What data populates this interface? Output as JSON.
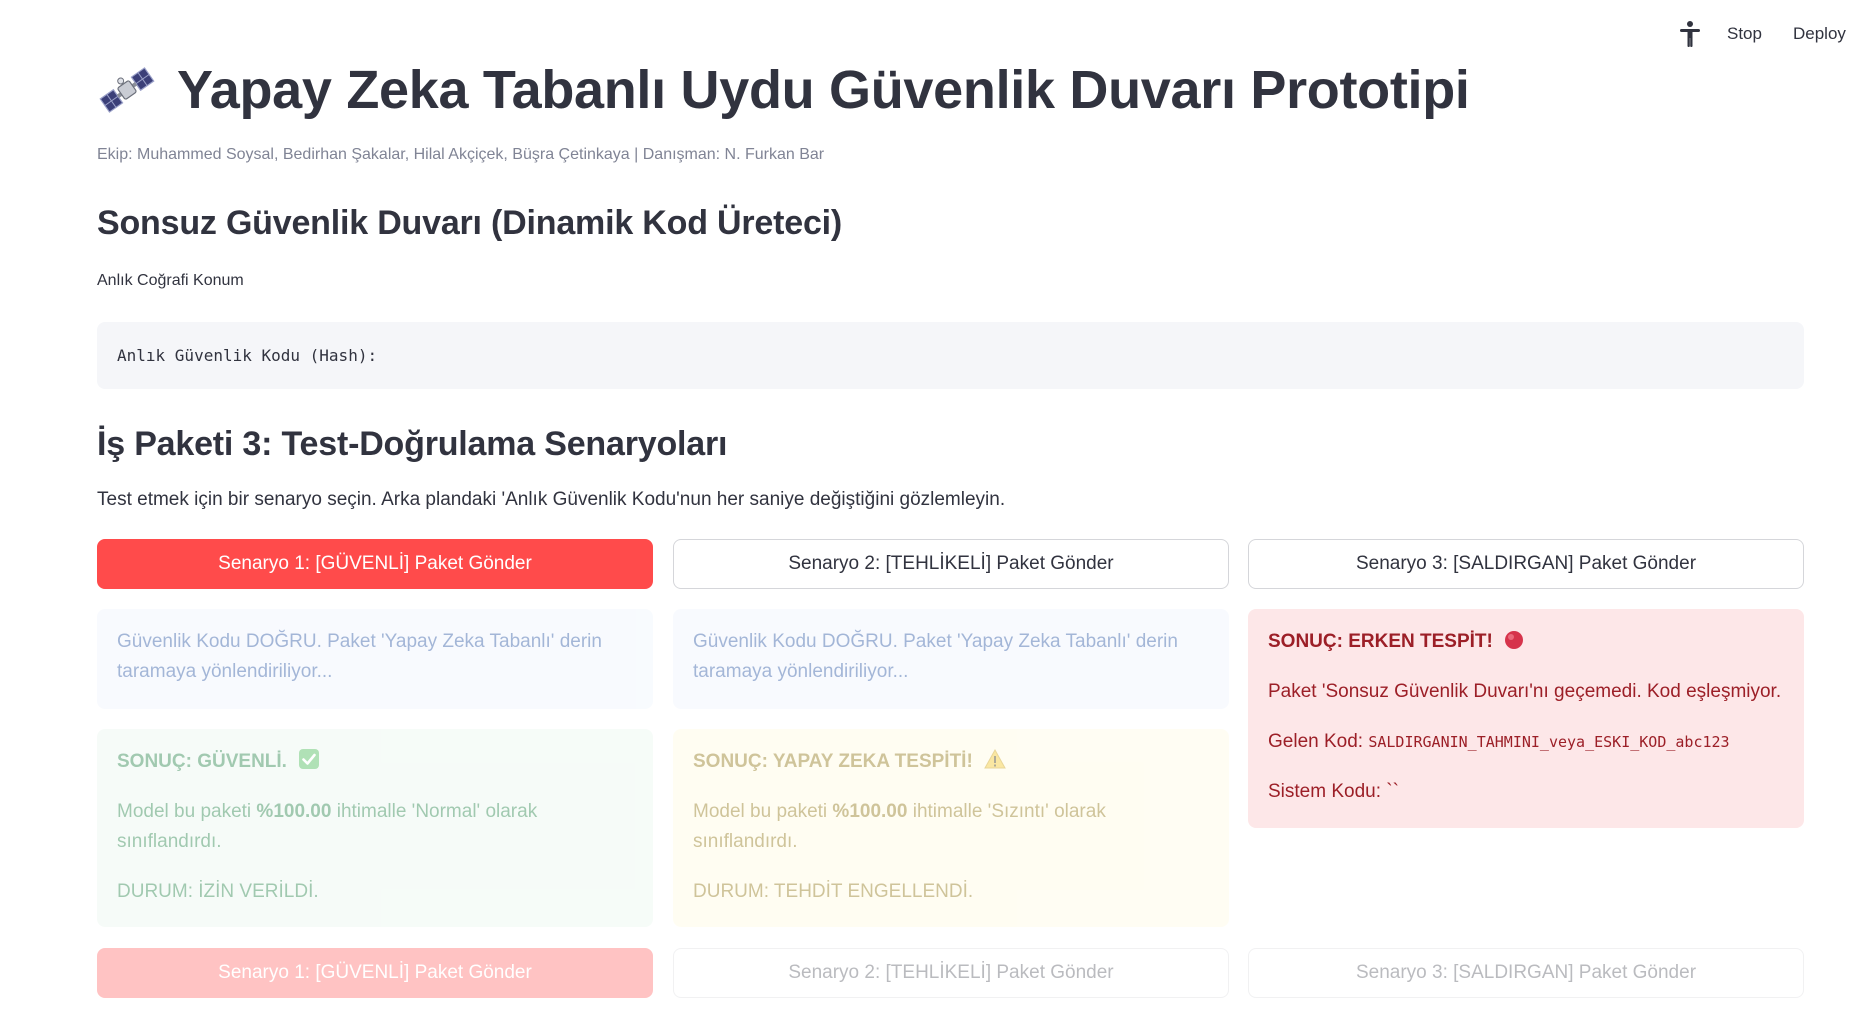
{
  "toolbar": {
    "stop_label": "Stop",
    "deploy_label": "Deploy"
  },
  "header": {
    "title": "Yapay Zeka Tabanlı Uydu Güvenlik Duvarı Prototipi",
    "caption": "Ekip: Muhammed Soysal, Bedirhan Şakalar, Hilal Akçiçek, Büşra Çetinkaya | Danışman: N. Furkan Bar"
  },
  "section1": {
    "heading": "Sonsuz Güvenlik Duvarı (Dinamik Kod Üreteci)",
    "location_label": "Anlık Coğrafi Konum",
    "hash_code": "Anlık Güvenlik Kodu (Hash):"
  },
  "section2": {
    "heading": "İş Paketi 3: Test-Doğrulama Senaryoları",
    "description": "Test etmek için bir senaryo seçin. Arka plandaki 'Anlık Güvenlik Kodu'nun her saniye değiştiğini gözlemleyin.",
    "buttons": {
      "scenario1": "Senaryo 1: [GÜVENLİ] Paket Gönder",
      "scenario2": "Senaryo 2: [TEHLİKELİ] Paket Gönder",
      "scenario3": "Senaryo 3: [SALDIRGAN] Paket Gönder"
    },
    "col1": {
      "info": "Güvenlik Kodu DOĞRU. Paket 'Yapay Zeka Tabanlı' derin taramaya yönlendiriliyor...",
      "result_title": "SONUÇ: GÜVENLİ.",
      "model_prefix": "Model bu paketi ",
      "probability": "%100.00",
      "model_suffix": " ihtimalle 'Normal' olarak sınıflandırdı.",
      "status": "DURUM: İZİN VERİLDİ."
    },
    "col2": {
      "info": "Güvenlik Kodu DOĞRU. Paket 'Yapay Zeka Tabanlı' derin taramaya yönlendiriliyor...",
      "result_title": "SONUÇ: YAPAY ZEKA TESPİTİ!",
      "model_prefix": "Model bu paketi ",
      "probability": "%100.00",
      "model_suffix": " ihtimalle 'Sızıntı' olarak sınıflandırdı.",
      "status": "DURUM: TEHDİT ENGELLENDİ."
    },
    "col3": {
      "result_title": "SONUÇ: ERKEN TESPİT!",
      "message": "Paket 'Sonsuz Güvenlik Duvarı'nı geçemedi. Kod eşleşmiyor.",
      "incoming_label": "Gelen Kod: ",
      "incoming_code": "SALDIRGANIN_TAHMINI_veya_ESKI_KOD_abc123",
      "system_code": "Sistem Kodu: ``"
    }
  },
  "colors": {
    "primary": "#ff4b4b",
    "info_bg": "#eef4fd",
    "success_bg": "#e9f7ee",
    "warning_bg": "#fffbe1",
    "error_bg": "#fde7e8"
  }
}
